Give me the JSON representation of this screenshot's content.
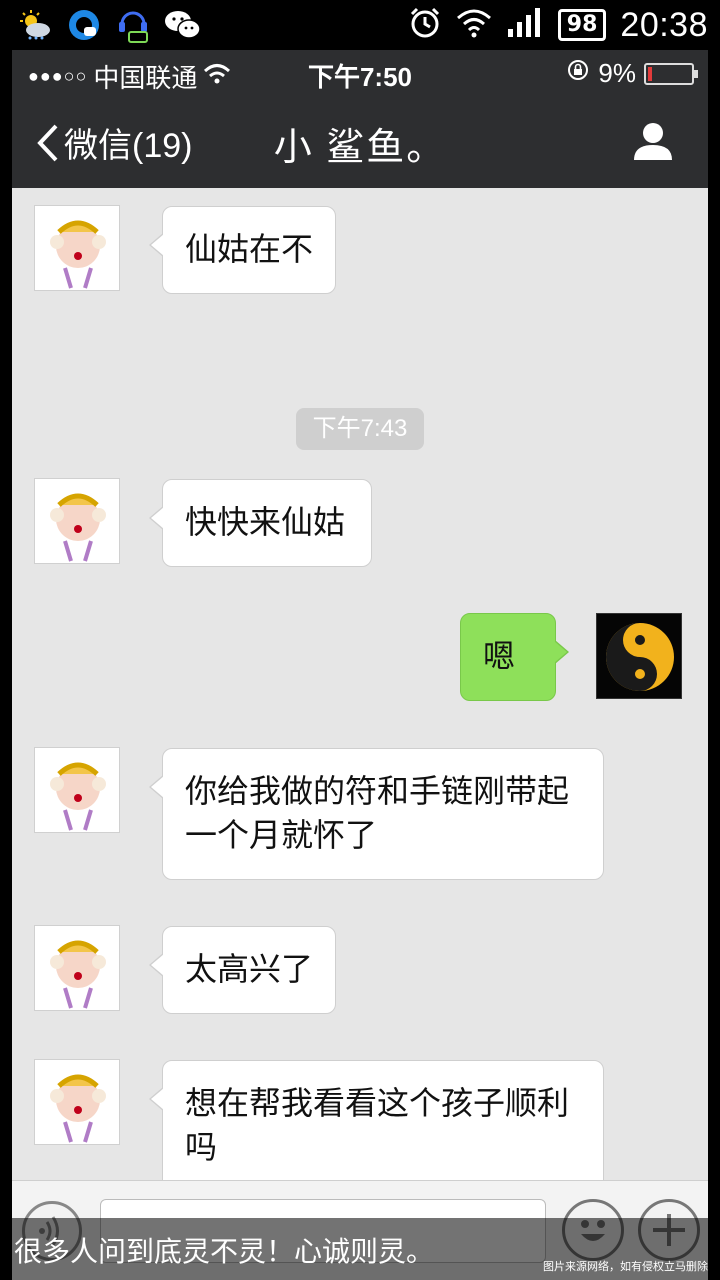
{
  "android_status": {
    "time": "20:38",
    "battery": "98",
    "icons": [
      "weather-sun-cloud-icon",
      "q-browser-icon",
      "chat-agent-icon",
      "wechat-icon",
      "alarm-icon",
      "wifi-icon",
      "signal-icon"
    ]
  },
  "ios_status": {
    "signal_dots": "●●●○○",
    "carrier": "中国联通",
    "time": "下午7:50",
    "battery_percent": "9%",
    "battery_level": 0.09,
    "battery_color": "#e23b3b"
  },
  "nav": {
    "back_label": "微信(19)",
    "title": "小 鲨鱼。",
    "profile_icon": "person-icon"
  },
  "messages": [
    {
      "side": "left",
      "text": "仙姑在不"
    },
    {
      "side": "left",
      "text": "快快来仙姑"
    },
    {
      "side": "right",
      "text": "嗯"
    },
    {
      "side": "left",
      "text": "你给我做的符和手链刚带起一个月就怀了"
    },
    {
      "side": "left",
      "text": "太高兴了"
    },
    {
      "side": "left",
      "text": "想在帮我看看这个孩子顺利吗"
    }
  ],
  "timestamp": "下午7:43",
  "input": {
    "value": "",
    "voice_icon": "voice-icon",
    "emoji_icon": "emoji-icon",
    "plus_icon": "plus-icon"
  },
  "overlay": {
    "caption": "很多人问到底灵不灵！心诚则灵。",
    "watermark": "图片来源网络，如有侵权立马删除"
  },
  "colors": {
    "nav_bg": "#2d2e30",
    "chat_bg": "#e6e6e6",
    "bubble_right": "#8ee05a",
    "bubble_left": "#ffffff"
  }
}
